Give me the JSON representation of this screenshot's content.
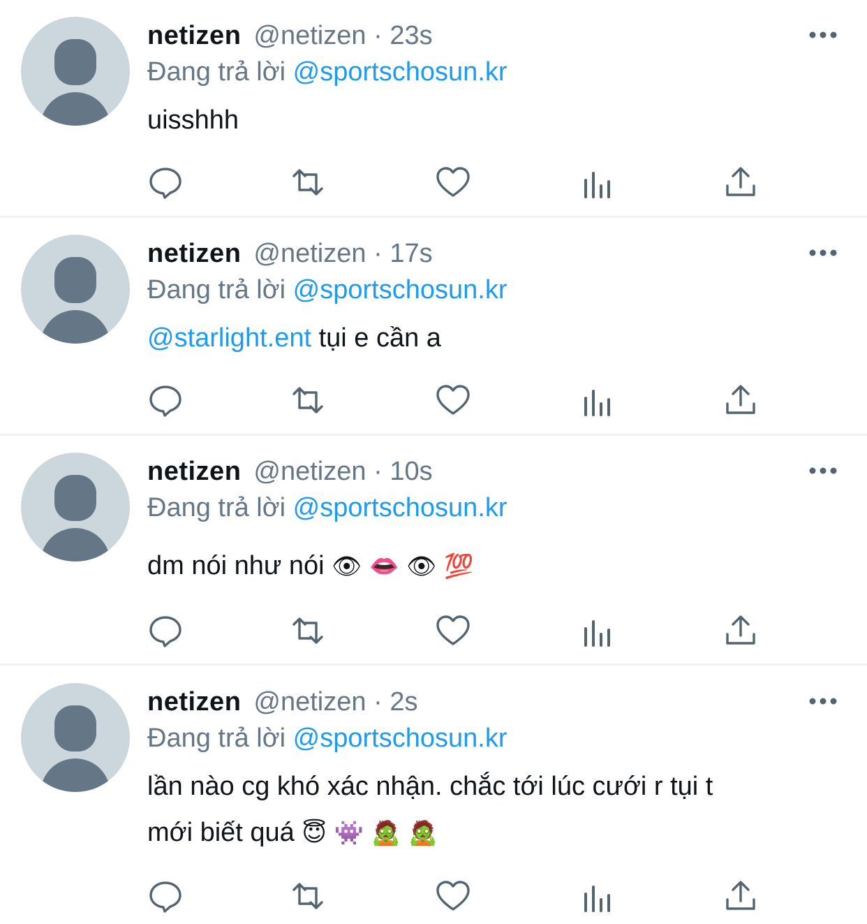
{
  "reply_prefix": "Đang trả lời",
  "tweets": [
    {
      "name": "netizen",
      "handle": "@netizen",
      "separator": "·",
      "time": "23s",
      "reply_to": "@sportschosun.kr",
      "text": "uisshhh"
    },
    {
      "name": "netizen",
      "handle": "@netizen",
      "separator": "·",
      "time": "17s",
      "reply_to": "@sportschosun.kr",
      "mention": "@starlight.ent",
      "text": " tụi e cần a"
    },
    {
      "name": "netizen",
      "handle": "@netizen",
      "separator": "·",
      "time": "10s",
      "reply_to": "@sportschosun.kr",
      "text": "dm nói như nói",
      "emojis": "👁 👄 👁 💯"
    },
    {
      "name": "netizen",
      "handle": "@netizen",
      "separator": "·",
      "time": "2s",
      "reply_to": "@sportschosun.kr",
      "text": "lần nào cg khó xác nhận. chắc tới lúc cưới r tụi t",
      "text_line2": "mới biết quá",
      "emojis": "😇 👾 🧟 🧟"
    }
  ],
  "colors": {
    "accent": "#1d9bf0",
    "muted": "#657786",
    "text": "#0f1419",
    "avatar_bg": "#ccd6dd",
    "divider": "#eff1f3"
  },
  "icons": [
    "more-icon",
    "reply-icon",
    "retweet-icon",
    "like-icon",
    "views-icon",
    "share-icon"
  ]
}
